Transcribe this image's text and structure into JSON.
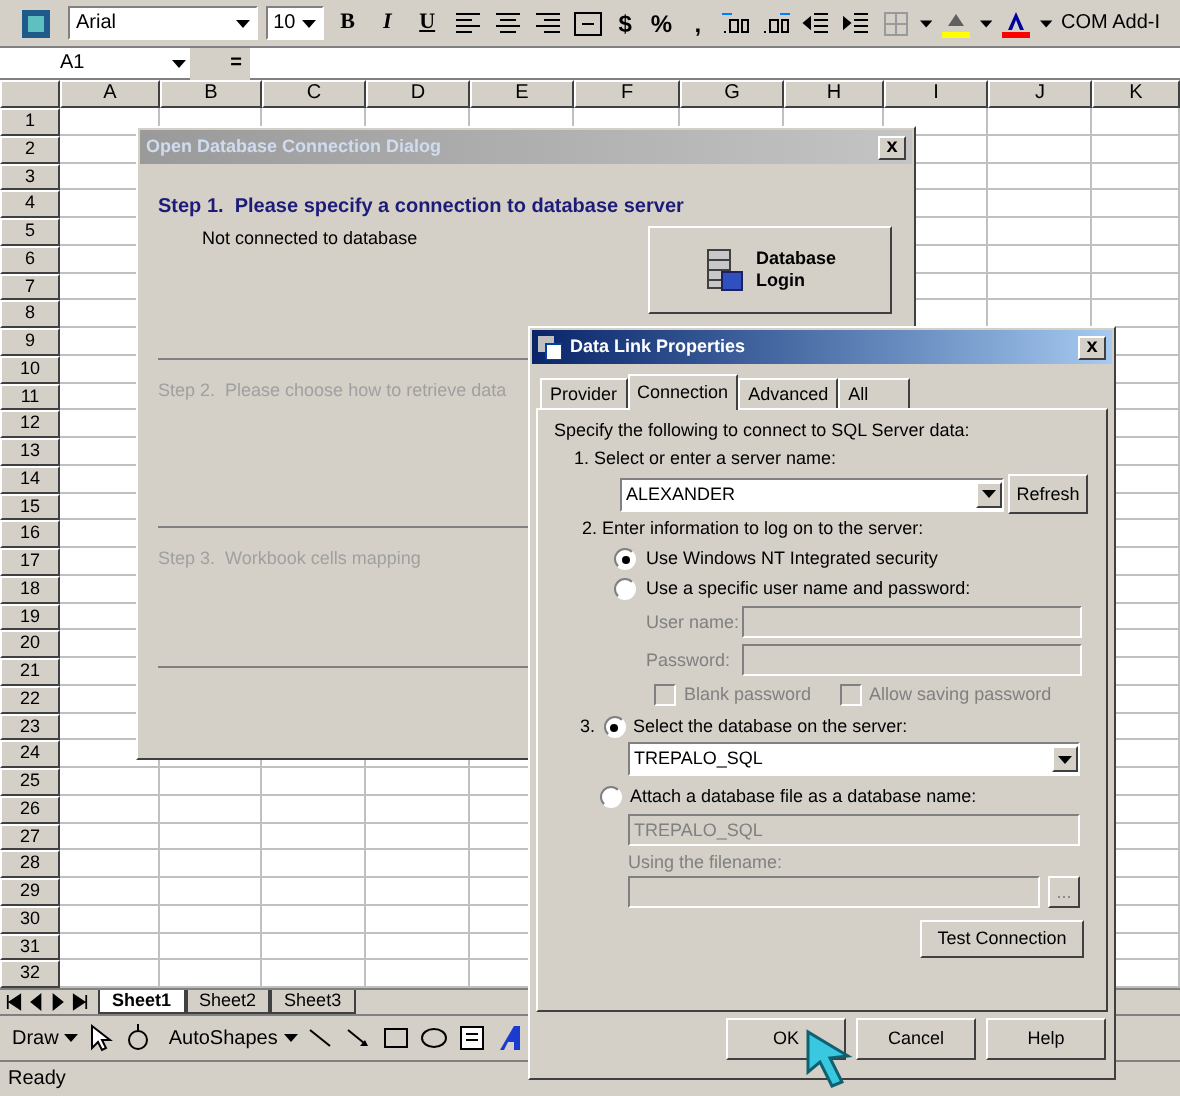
{
  "toolbar": {
    "font": "Arial",
    "font_size": "10",
    "format_buttons": [
      "B",
      "I",
      "U"
    ],
    "number_buttons": [
      "$",
      "%",
      ","
    ],
    "addin": "COM Add-I"
  },
  "formula_bar": {
    "name_box": "A1",
    "equals": "="
  },
  "columns": [
    "A",
    "B",
    "C",
    "D",
    "E",
    "F",
    "G",
    "H",
    "I",
    "J",
    "K"
  ],
  "rows": [
    "1",
    "2",
    "3",
    "4",
    "5",
    "6",
    "7",
    "8",
    "9",
    "10",
    "11",
    "12",
    "13",
    "14",
    "15",
    "16",
    "17",
    "18",
    "19",
    "20",
    "21",
    "22",
    "23",
    "24",
    "25",
    "26",
    "27",
    "28",
    "29",
    "30",
    "31",
    "32"
  ],
  "sheet_tabs": [
    {
      "label": "Sheet1",
      "selected": true
    },
    {
      "label": "Sheet2",
      "selected": false
    },
    {
      "label": "Sheet3",
      "selected": false
    }
  ],
  "draw_toolbar": {
    "draw": "Draw",
    "autoshapes": "AutoShapes"
  },
  "status_bar": "Ready",
  "open_dialog": {
    "title": "Open Database Connection Dialog",
    "close": "x",
    "steps": [
      {
        "title": "Step 1.  Please specify a connection to database server",
        "enabled": true,
        "status": "Not connected to database",
        "login_button": [
          "Database",
          "Login"
        ]
      },
      {
        "title": "Step 2.  Please choose how to retrieve data",
        "enabled": false
      },
      {
        "title": "Step 3.  Workbook cells mapping",
        "enabled": false
      }
    ]
  },
  "data_link": {
    "title": "Data Link Properties",
    "close": "x",
    "tabs": [
      {
        "label": "Provider",
        "selected": false
      },
      {
        "label": "Connection",
        "selected": true
      },
      {
        "label": "Advanced",
        "selected": false
      },
      {
        "label": "All",
        "selected": false
      }
    ],
    "intro": "Specify the following to connect to SQL Server data:",
    "step1": "1. Select or enter a server name:",
    "server": "ALEXANDER",
    "refresh": "Refresh",
    "step2": "2. Enter information to log on to the server:",
    "auth_options": [
      {
        "label": "Use Windows NT Integrated security",
        "selected": true
      },
      {
        "label": "Use a specific user name and password:",
        "selected": false
      }
    ],
    "credentials": {
      "disabled": true,
      "user_label": "User name:",
      "password_label": "Password:",
      "checkboxes": [
        {
          "label": "Blank password",
          "checked": false
        },
        {
          "label": "Allow saving password",
          "checked": false
        }
      ]
    },
    "db_options": [
      {
        "number": "3.",
        "label": "Select the database on the server:",
        "selected": true
      },
      {
        "label": "Attach a database file as a database name:",
        "selected": false
      }
    ],
    "database": "TREPALO_SQL",
    "attach_name": "TREPALO_SQL",
    "filename_label": "Using the filename:",
    "browse": "...",
    "test_button": "Test Connection",
    "buttons": [
      "OK",
      "Cancel",
      "Help"
    ]
  }
}
